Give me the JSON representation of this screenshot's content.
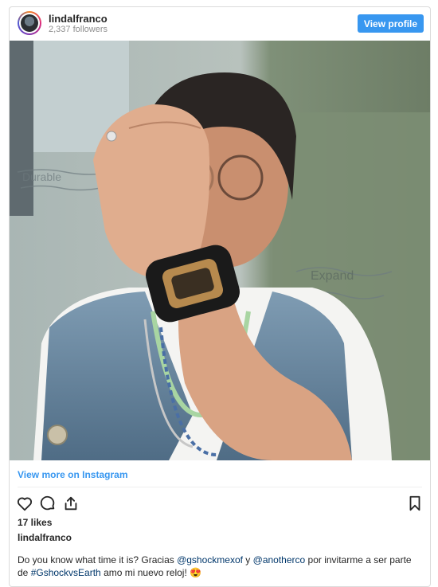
{
  "header": {
    "username": "lindalfranco",
    "followers": "2,337 followers",
    "view_profile_label": "View profile"
  },
  "post": {
    "view_more_label": "View more on Instagram",
    "likes": "17 likes",
    "author": "lindalfranco",
    "caption": {
      "part1": "Do you know what time it is? Gracias ",
      "mention1": "@gshockmexof",
      "part2": " y ",
      "mention2": "@anotherco",
      "part3": " por invitarme a ser parte de ",
      "hashtag": "#GshockvsEarth",
      "part4": " amo mi nuevo reloj! ",
      "emoji": "😍"
    },
    "whiteboard_texts": [
      "Expand",
      "Durable"
    ]
  },
  "icons": {
    "like": "heart-icon",
    "comment": "comment-icon",
    "share": "share-icon",
    "save": "bookmark-icon"
  },
  "colors": {
    "accent": "#3897f0",
    "link": "#00376b",
    "text": "#262626",
    "muted": "#8e8e8e"
  }
}
